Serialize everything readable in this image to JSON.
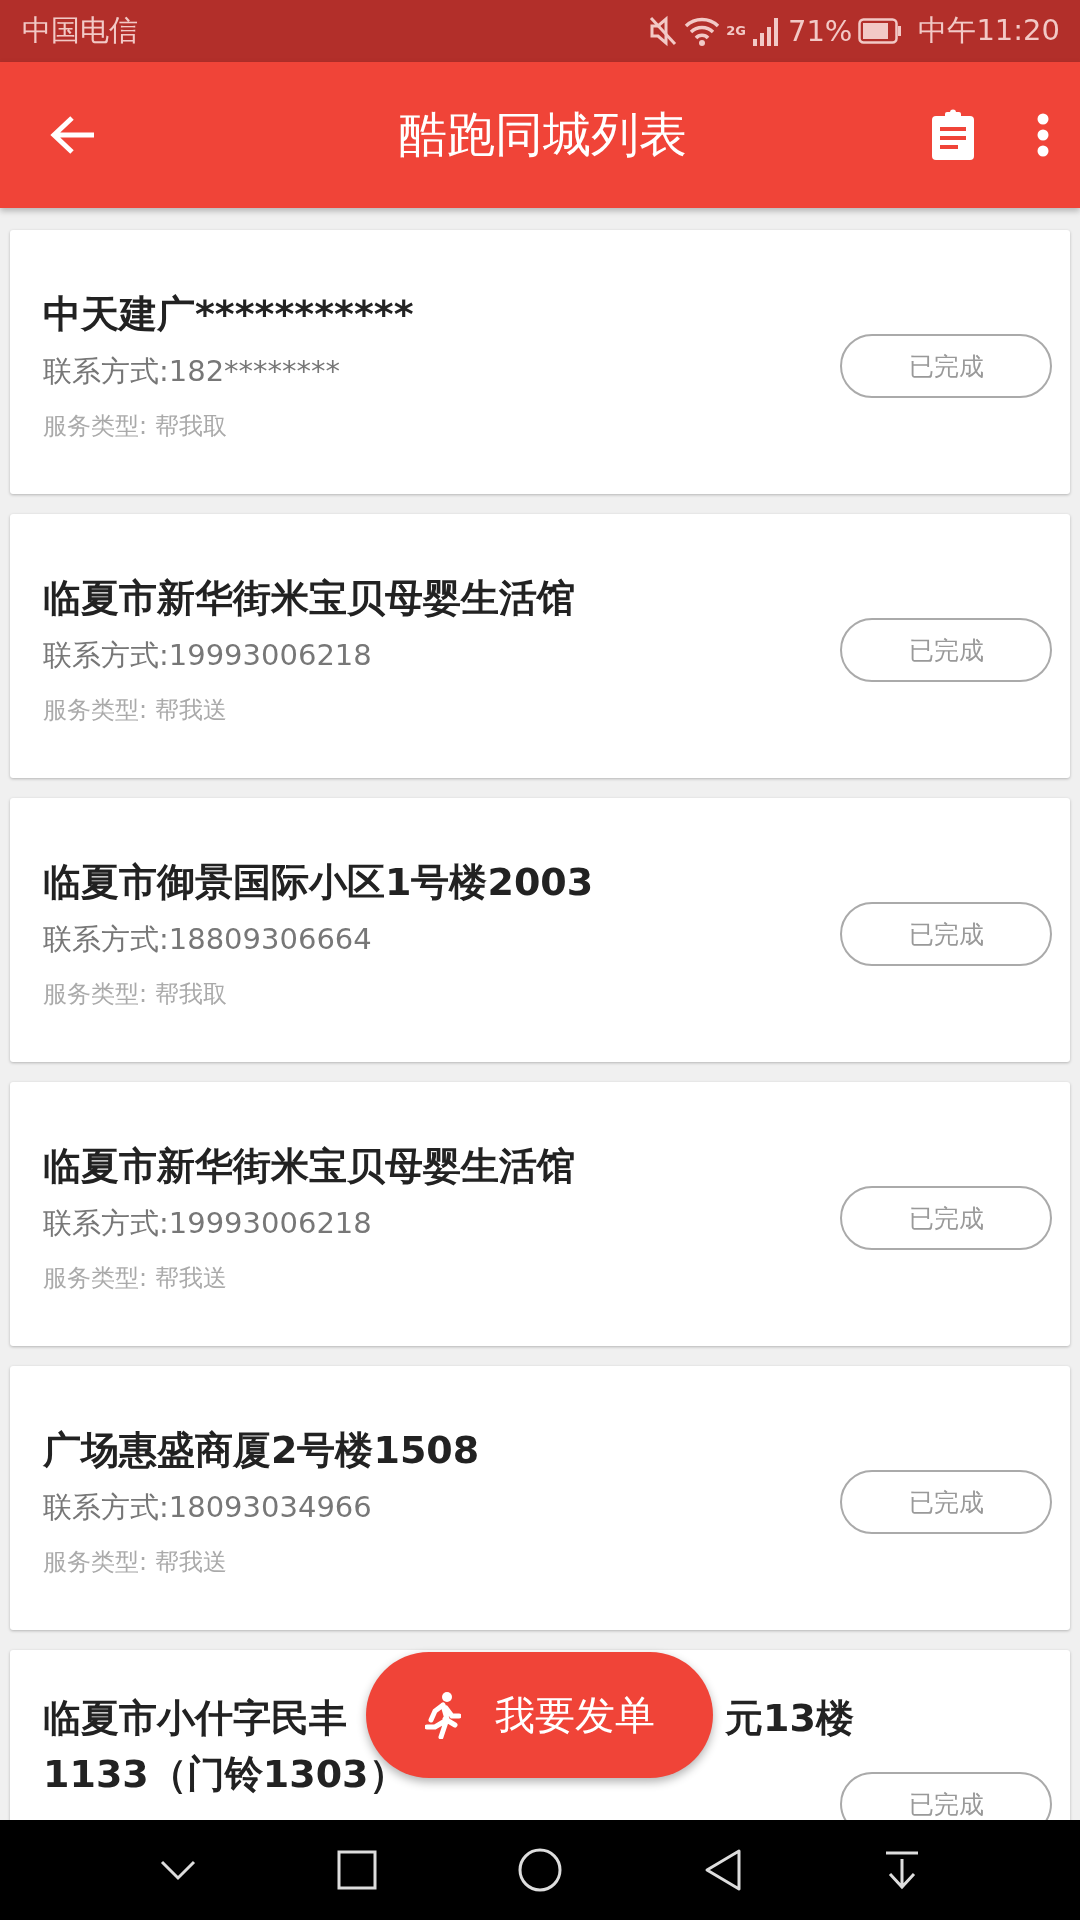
{
  "status_bar": {
    "carrier": "中国电信",
    "network": "2G",
    "battery": "71%",
    "time": "中午11:20"
  },
  "app_bar": {
    "title": "酷跑同城列表"
  },
  "orders": [
    {
      "title": "中天建广***********",
      "contact": "联系方式:182********",
      "service": "服务类型: 帮我取",
      "action": "已完成"
    },
    {
      "title": "临夏市新华街米宝贝母婴生活馆",
      "contact": "联系方式:19993006218",
      "service": "服务类型: 帮我送",
      "action": "已完成"
    },
    {
      "title": "临夏市御景国际小区1号楼2003",
      "contact": "联系方式:18809306664",
      "service": "服务类型: 帮我取",
      "action": "已完成"
    },
    {
      "title": "临夏市新华街米宝贝母婴生活馆",
      "contact": "联系方式:19993006218",
      "service": "服务类型: 帮我送",
      "action": "已完成"
    },
    {
      "title": "广场惠盛商厦2号楼1508",
      "contact": "联系方式:18093034966",
      "service": "服务类型: 帮我送",
      "action": "已完成"
    },
    {
      "title_parts": [
        "临夏市小什字民丰",
        "元13楼",
        "1133（门铃1303）"
      ],
      "action": "已完成"
    }
  ],
  "fab": {
    "label": "我要发单"
  }
}
